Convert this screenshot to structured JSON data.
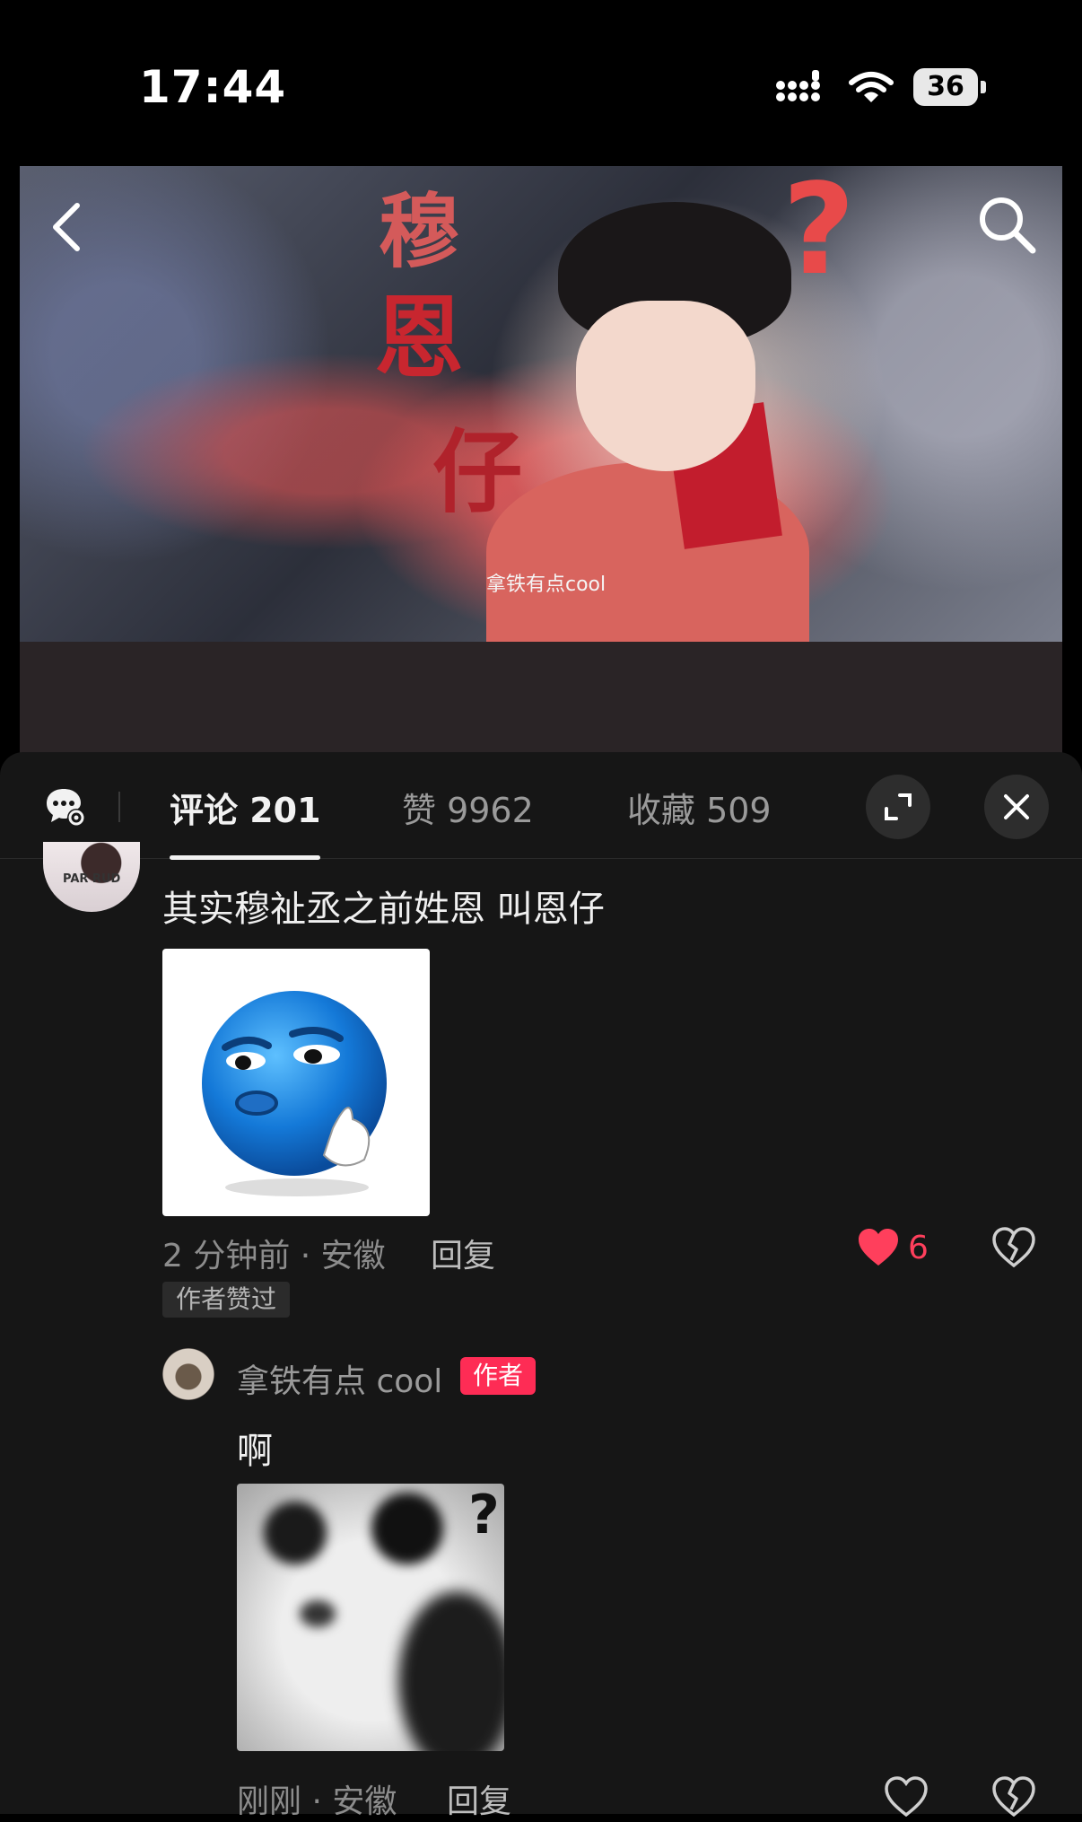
{
  "status_bar": {
    "time": "17:44",
    "battery": "36"
  },
  "video": {
    "title_chars": [
      "穆",
      "恩",
      "仔"
    ],
    "question_mark": "?",
    "watermark": "拿铁有点cool"
  },
  "tabs": [
    {
      "label": "评论 201",
      "active": true
    },
    {
      "label": "赞 9962",
      "active": false
    },
    {
      "label": "收藏 509",
      "active": false
    }
  ],
  "comment": {
    "avatar_text": "PAR RUD",
    "text": "其实穆祉丞之前姓恩 叫恩仔",
    "meta": "2 分钟前 · 安徽",
    "reply_label": "回复",
    "badge": "作者赞过",
    "like_count": "6",
    "liked": true
  },
  "reply": {
    "author": "拿铁有点 cool",
    "author_tag": "作者",
    "text": "啊",
    "meta": "刚刚 · 安徽",
    "reply_label": "回复"
  },
  "colors": {
    "accent": "#fe2c55",
    "panel_bg": "#161616",
    "like_red": "#ff3f5c"
  }
}
